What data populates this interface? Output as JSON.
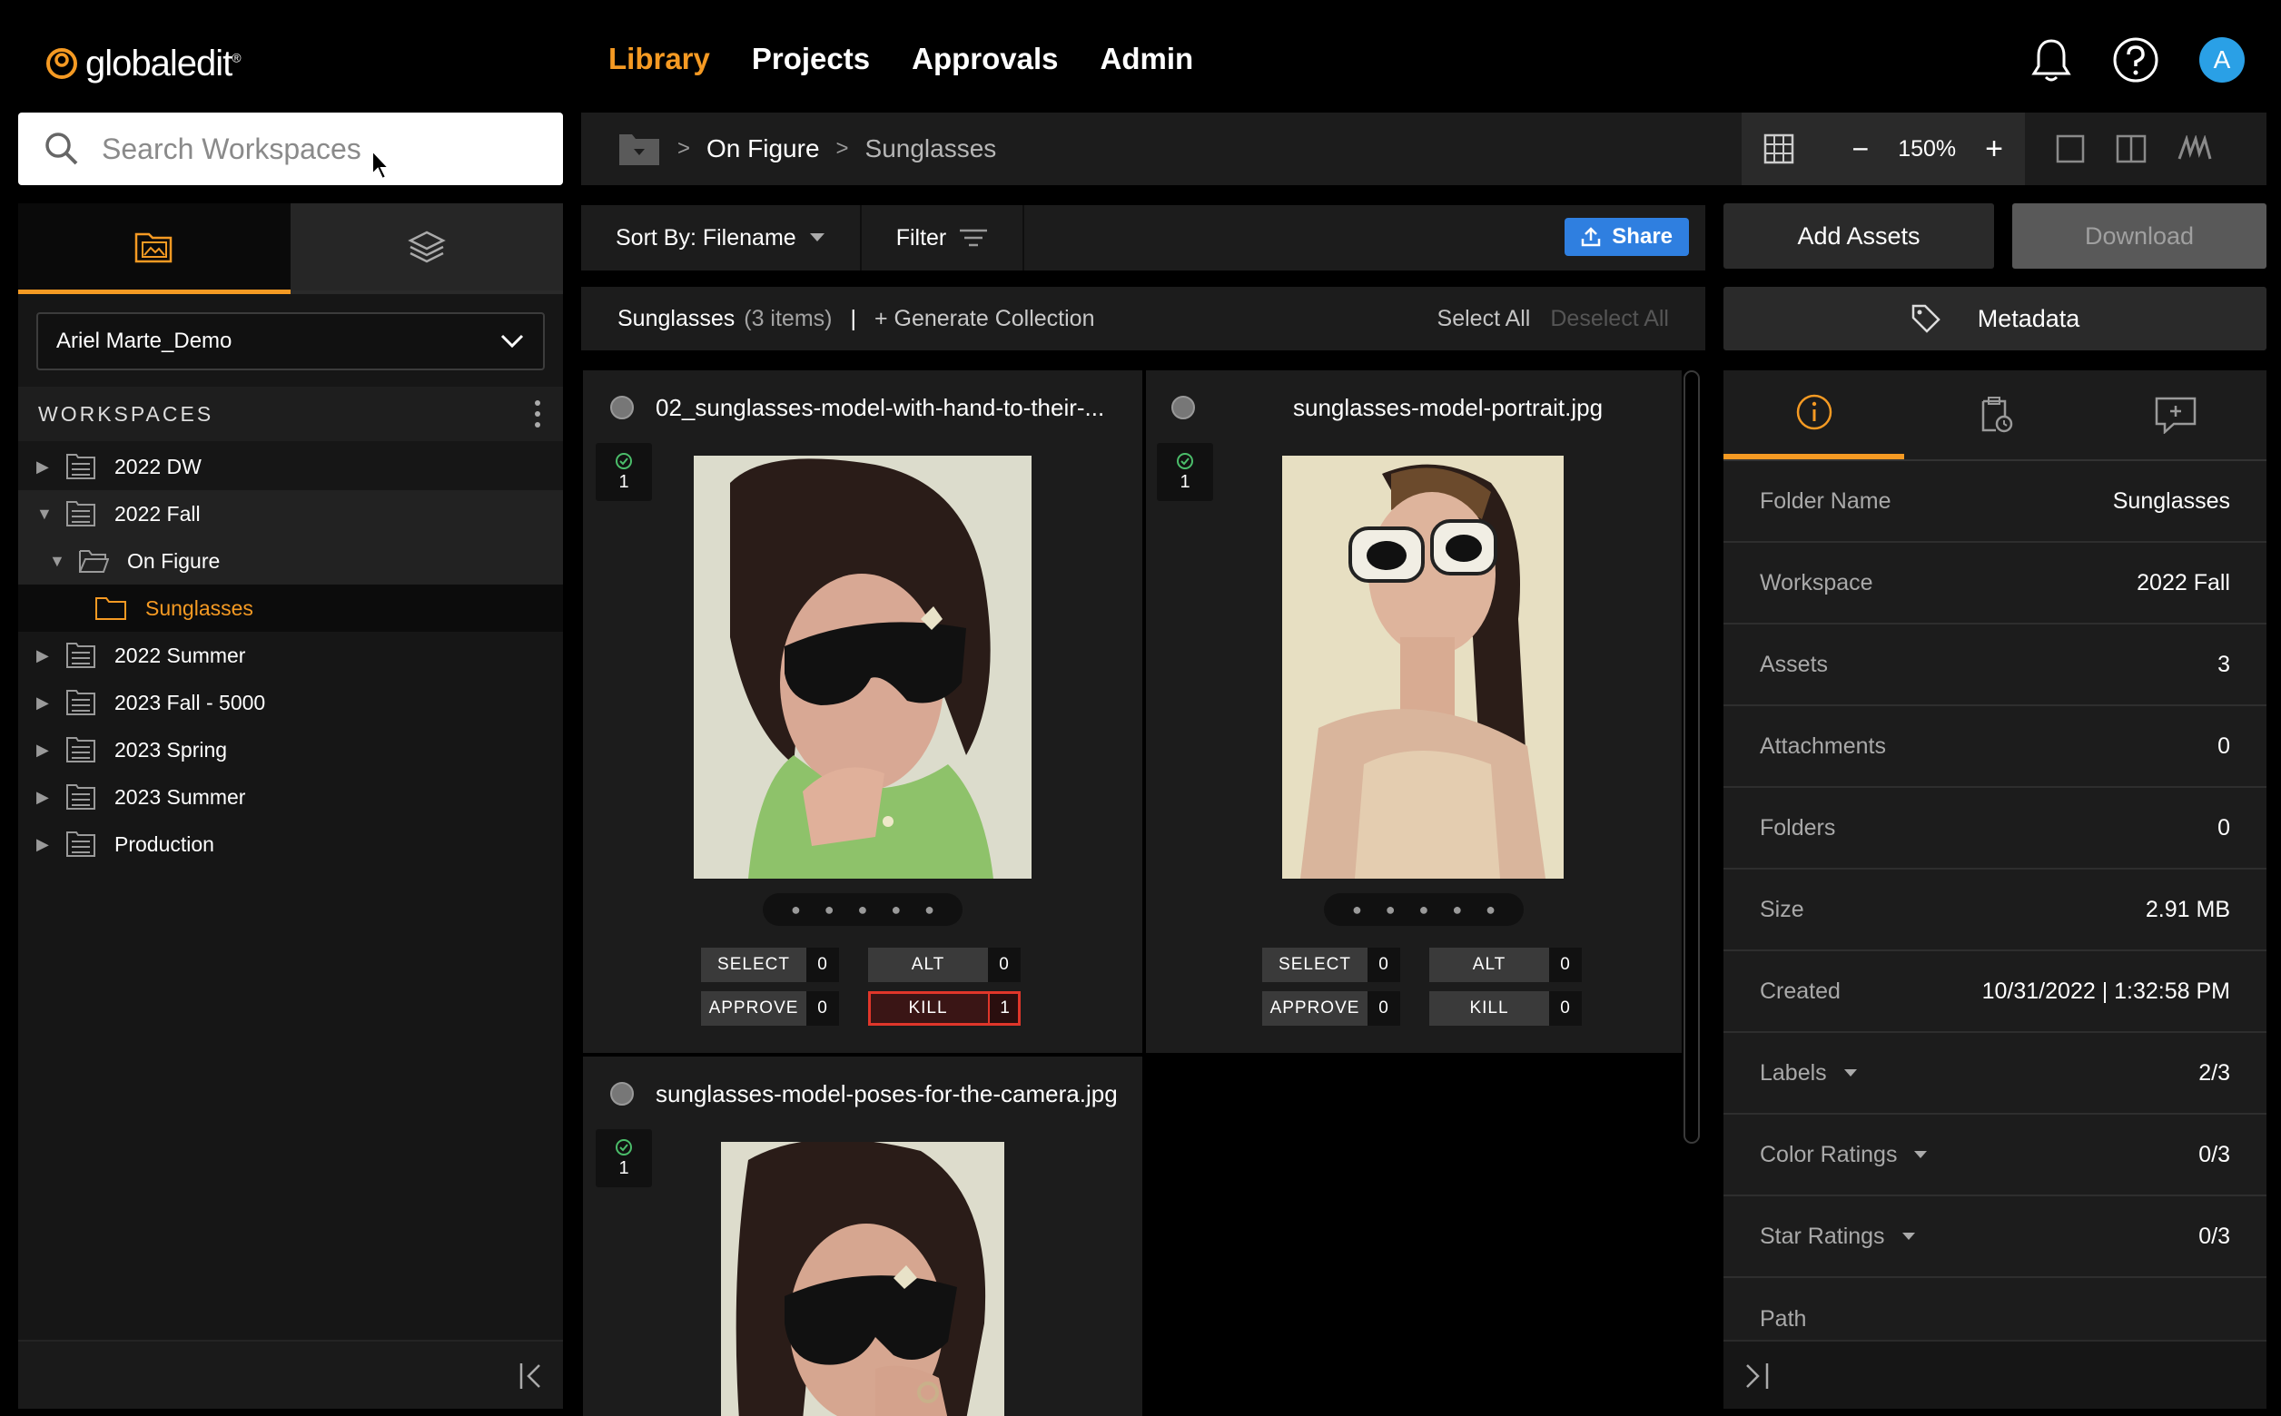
{
  "app": {
    "logo_text": "globaledit",
    "logo_reg": "®"
  },
  "nav": {
    "items": [
      {
        "label": "Library",
        "active": true
      },
      {
        "label": "Projects",
        "active": false
      },
      {
        "label": "Approvals",
        "active": false
      },
      {
        "label": "Admin",
        "active": false
      }
    ]
  },
  "header": {
    "icons": [
      "bell-icon",
      "help-icon"
    ],
    "avatar_initial": "A"
  },
  "search": {
    "placeholder": "Search Workspaces",
    "value": ""
  },
  "sidebar": {
    "tabs": [
      "folder-image-icon",
      "layers-icon"
    ],
    "workspace_selector": "Ariel Marte_Demo",
    "workspaces_heading": "WORKSPACES",
    "tree": [
      {
        "label": "2022 DW",
        "level": 0,
        "expanded": false
      },
      {
        "label": "2022 Fall",
        "level": 0,
        "expanded": true
      },
      {
        "label": "On Figure",
        "level": 1,
        "expanded": true
      },
      {
        "label": "Sunglasses",
        "level": 2,
        "selected": true
      },
      {
        "label": "2022 Summer",
        "level": 0,
        "expanded": false
      },
      {
        "label": "2023 Fall - 5000",
        "level": 0,
        "expanded": false
      },
      {
        "label": "2023 Spring",
        "level": 0,
        "expanded": false
      },
      {
        "label": "2023 Summer",
        "level": 0,
        "expanded": false
      },
      {
        "label": "Production",
        "level": 0,
        "expanded": false
      }
    ]
  },
  "breadcrumb": {
    "sep": ">",
    "items": [
      "On Figure",
      "Sunglasses"
    ]
  },
  "view": {
    "zoom": "150%",
    "minus": "−",
    "plus": "+"
  },
  "toolbar": {
    "sort_label": "Sort By: Filename",
    "filter_label": "Filter",
    "share_label": "Share",
    "add_assets_label": "Add Assets",
    "download_label": "Download"
  },
  "collection": {
    "name": "Sunglasses",
    "count": "(3 items)",
    "pipe": "|",
    "generate_label": "+ Generate Collection",
    "select_all": "Select All",
    "deselect_all": "Deselect All",
    "metadata_label": "Metadata"
  },
  "assets": [
    {
      "filename": "02_sunglasses-model-with-hand-to-their-...",
      "version": "1",
      "buttons": {
        "select": "SELECT",
        "select_count": "0",
        "alt": "ALT",
        "alt_count": "0",
        "approve": "APPROVE",
        "approve_count": "0",
        "kill": "KILL",
        "kill_count": "1"
      },
      "kill_active": true
    },
    {
      "filename": "sunglasses-model-portrait.jpg",
      "version": "1",
      "buttons": {
        "select": "SELECT",
        "select_count": "0",
        "alt": "ALT",
        "alt_count": "0",
        "approve": "APPROVE",
        "approve_count": "0",
        "kill": "KILL",
        "kill_count": "0"
      },
      "kill_active": false
    },
    {
      "filename": "sunglasses-model-poses-for-the-camera.jpg",
      "version": "1"
    }
  ],
  "info": {
    "tabs": [
      "info-icon",
      "clipboard-clock-icon",
      "comment-add-icon"
    ],
    "rows": [
      {
        "key": "Folder Name",
        "value": "Sunglasses"
      },
      {
        "key": "Workspace",
        "value": "2022 Fall"
      },
      {
        "key": "Assets",
        "value": "3"
      },
      {
        "key": "Attachments",
        "value": "0"
      },
      {
        "key": "Folders",
        "value": "0"
      },
      {
        "key": "Size",
        "value": "2.91 MB"
      },
      {
        "key": "Created",
        "value": "10/31/2022 | 1:32:58 PM"
      },
      {
        "key": "Labels",
        "value": "2/3",
        "dropdown": true
      },
      {
        "key": "Color Ratings",
        "value": "0/3",
        "dropdown": true
      },
      {
        "key": "Star Ratings",
        "value": "0/3",
        "dropdown": true
      },
      {
        "key": "Path",
        "value": ""
      }
    ]
  },
  "colors": {
    "accent": "#f59a23",
    "share_blue": "#2f7fe0",
    "kill_red": "#e0362a",
    "avatar_blue": "#2aa0e6"
  }
}
